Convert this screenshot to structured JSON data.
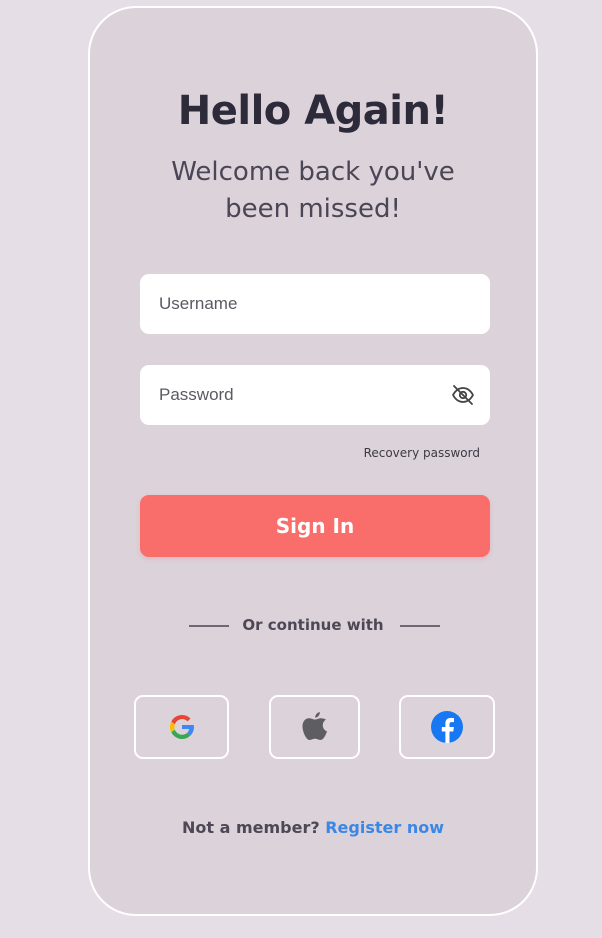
{
  "card": {
    "title": "Hello Again!",
    "subtitle": "Welcome back you've been missed!"
  },
  "form": {
    "username_placeholder": "Username",
    "password_placeholder": "Password",
    "password_toggle_icon": "eye-slash-icon",
    "recovery_label": "Recovery password",
    "signin_label": "Sign In"
  },
  "social": {
    "divider_label": "Or continue with",
    "buttons": [
      {
        "provider": "google",
        "icon": "google-icon"
      },
      {
        "provider": "apple",
        "icon": "apple-icon"
      },
      {
        "provider": "facebook",
        "icon": "facebook-icon"
      }
    ]
  },
  "footer": {
    "prompt": "Not a member?",
    "register_label": "Register now"
  },
  "colors": {
    "background": "#e6dee6",
    "card": "#dcd2da",
    "primary": "#f96d6a",
    "link": "#3b87e6",
    "title": "#2d2a3a"
  }
}
